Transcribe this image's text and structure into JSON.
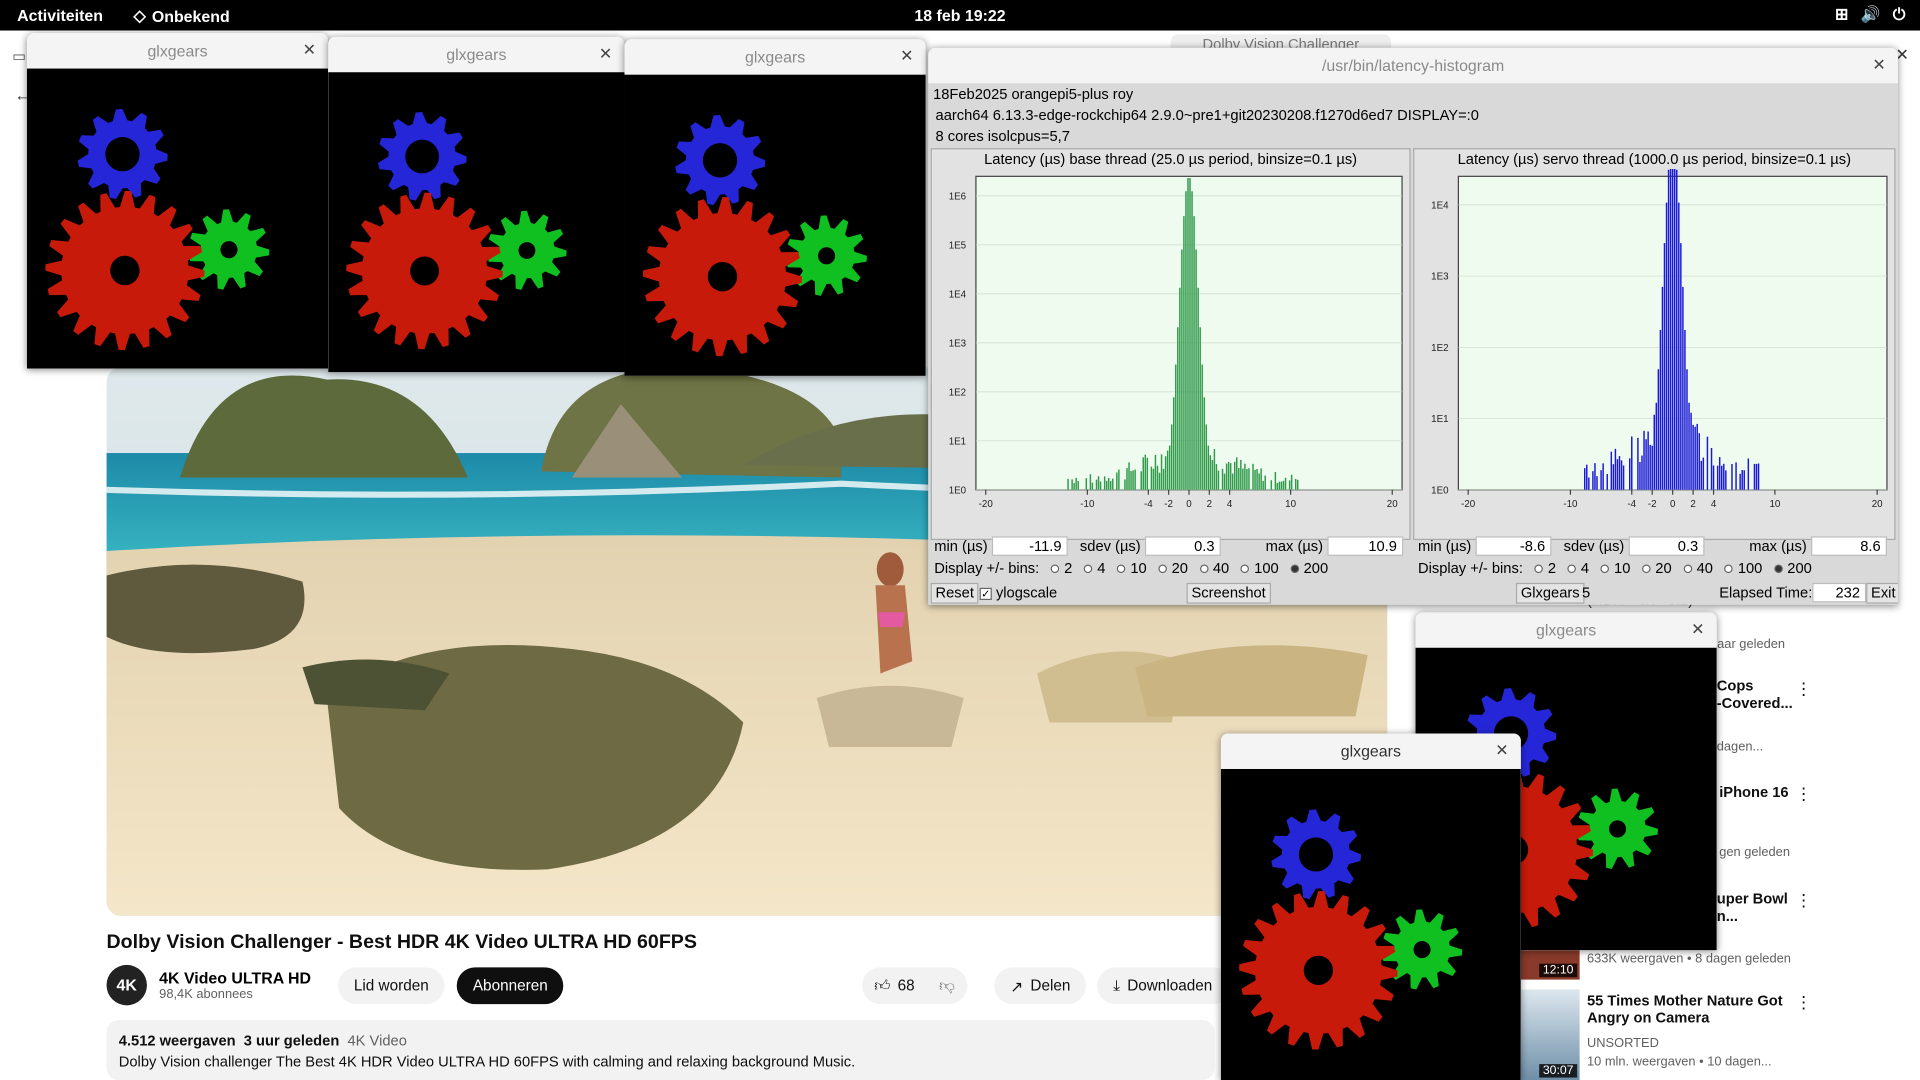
{
  "topbar": {
    "activities": "Activiteiten",
    "app": "Onbekend",
    "clock": "18 feb  19:22"
  },
  "youtube": {
    "tab_title": "Dolby Vision Challenger",
    "video_title": "Dolby Vision Challenger - Best HDR 4K Video ULTRA HD 60FPS",
    "channel_name": "4K Video ULTRA HD",
    "subscribers": "98,4K abonnees",
    "avatar_text": "4K",
    "join": "Lid worden",
    "subscribe": "Abonneren",
    "likes": "68",
    "share": "Delen",
    "download": "Downloaden",
    "views": "4.512 weergaven",
    "age": "3 uur geleden",
    "tag": "4K Video",
    "description": "Dolby Vision challenger The Best 4K HDR Video ULTRA HD 60FPS with calming and relaxing background Music.",
    "sidebar": [
      {
        "t": "(HDR - 4K - 8.1)",
        "m": "jaar geleden"
      },
      {
        "t": "Cops",
        "t2": "-Covered...",
        "m": "dagen..."
      },
      {
        "t": "iPhone 16",
        "m": "gen geleden"
      },
      {
        "t": "uper Bowl",
        "t2": "n...",
        "m": ""
      },
      {
        "t": "",
        "m": "633K weergaven • 8 dagen geleden",
        "d": "12:10"
      },
      {
        "t": "55 Times Mother Nature Got",
        "t2": "Angry on Camera",
        "c": "UNSORTED",
        "m": "10 mln. weergaven • 10 dagen...",
        "d": "30:07"
      }
    ]
  },
  "glx": {
    "title": "glxgears"
  },
  "hist": {
    "title": "/usr/bin/latency-histogram",
    "info1": "18Feb2025 orangepi5-plus roy",
    "info2": "aarch64  6.13.3-edge-rockchip64  2.9.0~pre1+git20230208.f1270d6ed7  DISPLAY=:0",
    "info3": "8 cores  isolcpus=5,7",
    "base": {
      "title": "Latency (µs) base thread (25.0 µs period, binsize=0.1 µs)",
      "min": "-11.9",
      "sdev": "0.3",
      "max": "10.9"
    },
    "servo": {
      "title": "Latency (µs) servo thread (1000.0 µs period, binsize=0.1 µs)",
      "min": "-8.6",
      "sdev": "0.3",
      "max": "8.6"
    },
    "lbl_min": "min (µs)",
    "lbl_sdev": "sdev (µs)",
    "lbl_max": "max (µs)",
    "lbl_bins": "Display +/- bins:",
    "bins": [
      "2",
      "4",
      "10",
      "20",
      "40",
      "100",
      "200"
    ],
    "reset": "Reset",
    "ylog": "ylogscale",
    "screenshot": "Screenshot",
    "glxgears": "Glxgears",
    "glx_count": "5",
    "elapsed_label": "Elapsed Time:",
    "elapsed": "232",
    "exit": "Exit"
  },
  "chart_data": [
    {
      "type": "bar",
      "title": "Latency (µs) base thread (25.0 µs period, binsize=0.1 µs)",
      "xlim": [
        -20,
        20
      ],
      "ylog": true,
      "x_ticks": [
        "-20",
        "-10",
        "-4",
        "-2",
        "0",
        "2",
        "4",
        "10",
        "20"
      ],
      "y_ticks": [
        "1E0",
        "1E1",
        "1E2",
        "1E3",
        "1E4",
        "1E5",
        "1E6"
      ],
      "peak_x": 0,
      "peak_log10_count": 6.4,
      "sdev": 0.3,
      "min": -11.9,
      "max": 10.9
    },
    {
      "type": "bar",
      "title": "Latency (µs) servo thread (1000.0 µs period, binsize=0.1 µs)",
      "xlim": [
        -20,
        20
      ],
      "ylog": true,
      "x_ticks": [
        "-20",
        "-10",
        "-4",
        "-2",
        "0",
        "2",
        "4",
        "10",
        "20"
      ],
      "y_ticks": [
        "1E0",
        "1E1",
        "1E2",
        "1E3",
        "1E4"
      ],
      "peak_x": 0,
      "peak_log10_count": 4.9,
      "sdev": 0.3,
      "min": -8.6,
      "max": 8.6
    }
  ]
}
